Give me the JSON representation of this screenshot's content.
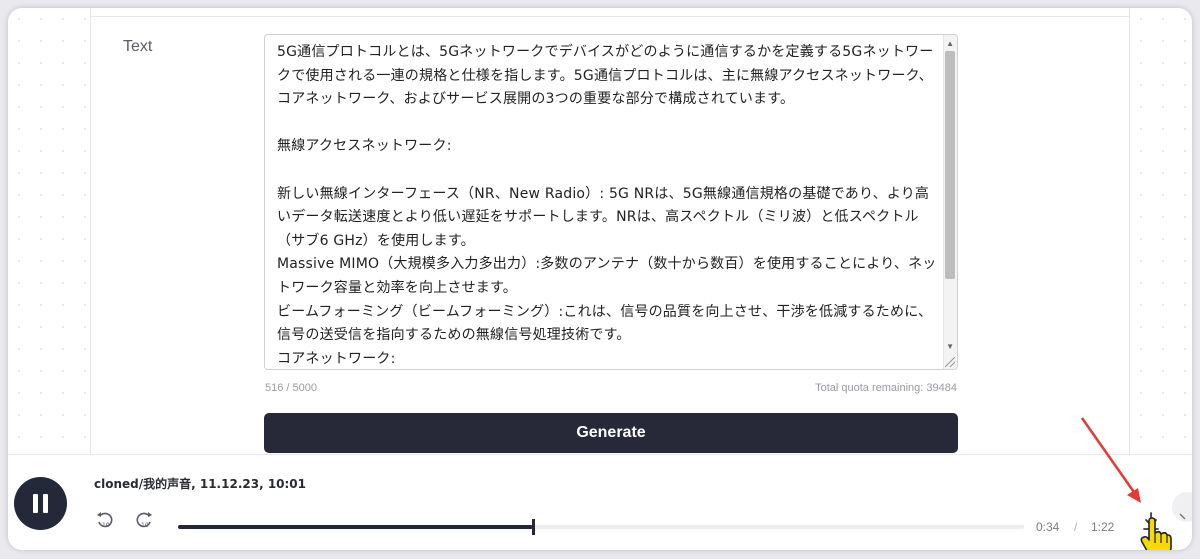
{
  "form": {
    "text_label": "Text",
    "text_value": "5G通信プロトコルとは、5Gネットワークでデバイスがどのように通信するかを定義する5Gネットワークで使用される一連の規格と仕様を指します。5G通信プロトコルは、主に無線アクセスネットワーク、コアネットワーク、およびサービス展開の3つの重要な部分で構成されています。\n\n無線アクセスネットワーク:\n\n新しい無線インターフェース（NR、New Radio）: 5G NRは、5G無線通信規格の基礎であり、より高いデータ転送速度とより低い遅延をサポートします。NRは、高スペクトル（ミリ波）と低スペクトル（サブ6 GHz）を使用します。\nMassive MIMO（大規模多入力多出力）:多数のアンテナ（数十から数百）を使用することにより、ネットワーク容量と効率を向上させます。\nビームフォーミング（ビームフォーミング）:これは、信号の品質を向上させ、干渉を低減するために、信号の送受信を指向するための無線信号処理技術です。\nコアネットワーク:",
    "char_count": "516 / 5000",
    "quota": "Total quota remaining: 39484",
    "generate_label": "Generate"
  },
  "player": {
    "title": "cloned/我的声音, 11.12.23, 10:01",
    "current_time": "0:34",
    "separator": "/",
    "total_time": "1:22",
    "progress": 0.42,
    "skip_seconds": "10"
  },
  "annotation": {
    "arrow_color": "#e53935",
    "cursor_color": "#f5d90a"
  },
  "colors": {
    "button_dark": "#272838",
    "accent_dark": "#24293a"
  }
}
